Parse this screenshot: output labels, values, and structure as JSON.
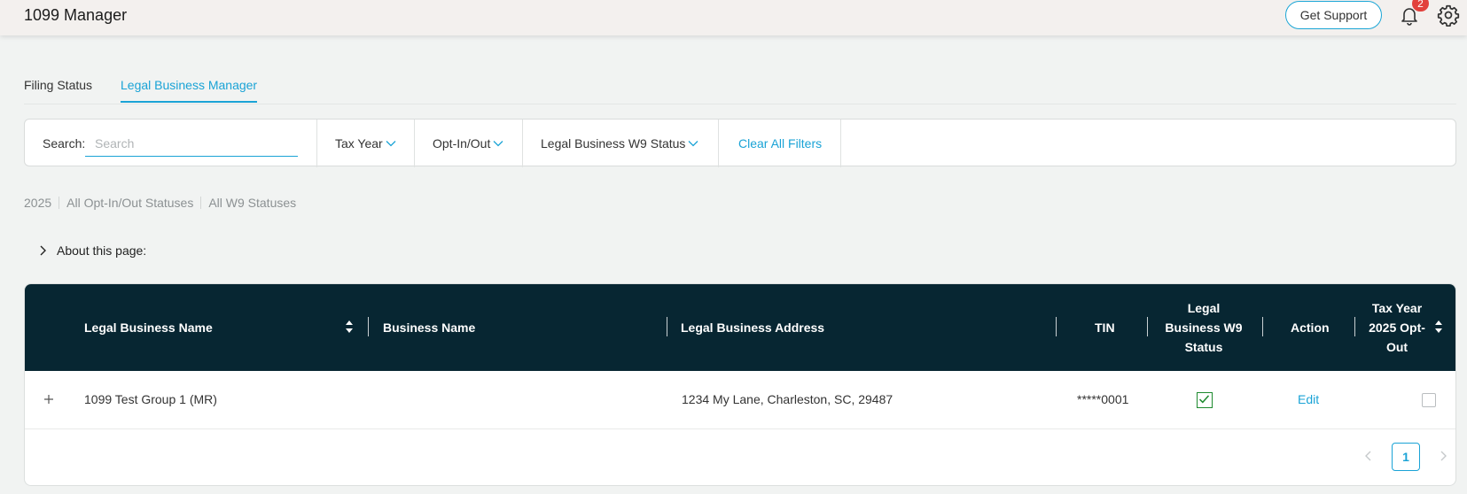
{
  "header": {
    "app_title": "1099 Manager",
    "support_label": "Get Support",
    "notification_count": "2",
    "bell_icon": "bell-icon",
    "settings_icon": "gear-icon"
  },
  "tabs": [
    {
      "label": "Filing Status",
      "active": false
    },
    {
      "label": "Legal Business Manager",
      "active": true
    }
  ],
  "filters": {
    "search_label": "Search:",
    "search_placeholder": "Search",
    "search_value": "",
    "tax_year_label": "Tax Year",
    "opt_label": "Opt-In/Out",
    "w9_label": "Legal Business W9 Status",
    "clear_label": "Clear All Filters"
  },
  "summary": [
    "2025",
    "All Opt-In/Out Statuses",
    "All W9 Statuses"
  ],
  "about_label": "About this page:",
  "table": {
    "columns": {
      "legal_name": "Legal Business Name",
      "business_name": "Business Name",
      "address": "Legal Business Address",
      "tin": "TIN",
      "w9_line1": "Legal",
      "w9_line2": "Business W9",
      "w9_line3": "Status",
      "action": "Action",
      "optout_line1": "Tax Year",
      "optout_line2": "2025 Opt-",
      "optout_line3": "Out"
    },
    "rows": [
      {
        "legal_name": "1099 Test Group 1 (MR)",
        "business_name": "",
        "address": "1234 My Lane, Charleston, SC, 29487",
        "tin": "*****0001",
        "w9_status_checked": true,
        "action_label": "Edit",
        "opt_out_checked": false
      }
    ]
  },
  "pagination": {
    "current_page": "1"
  },
  "colors": {
    "accent": "#1aa3d6",
    "header_bg": "#072632",
    "check_green": "#1d8a2e",
    "badge_red": "#e2413c"
  }
}
